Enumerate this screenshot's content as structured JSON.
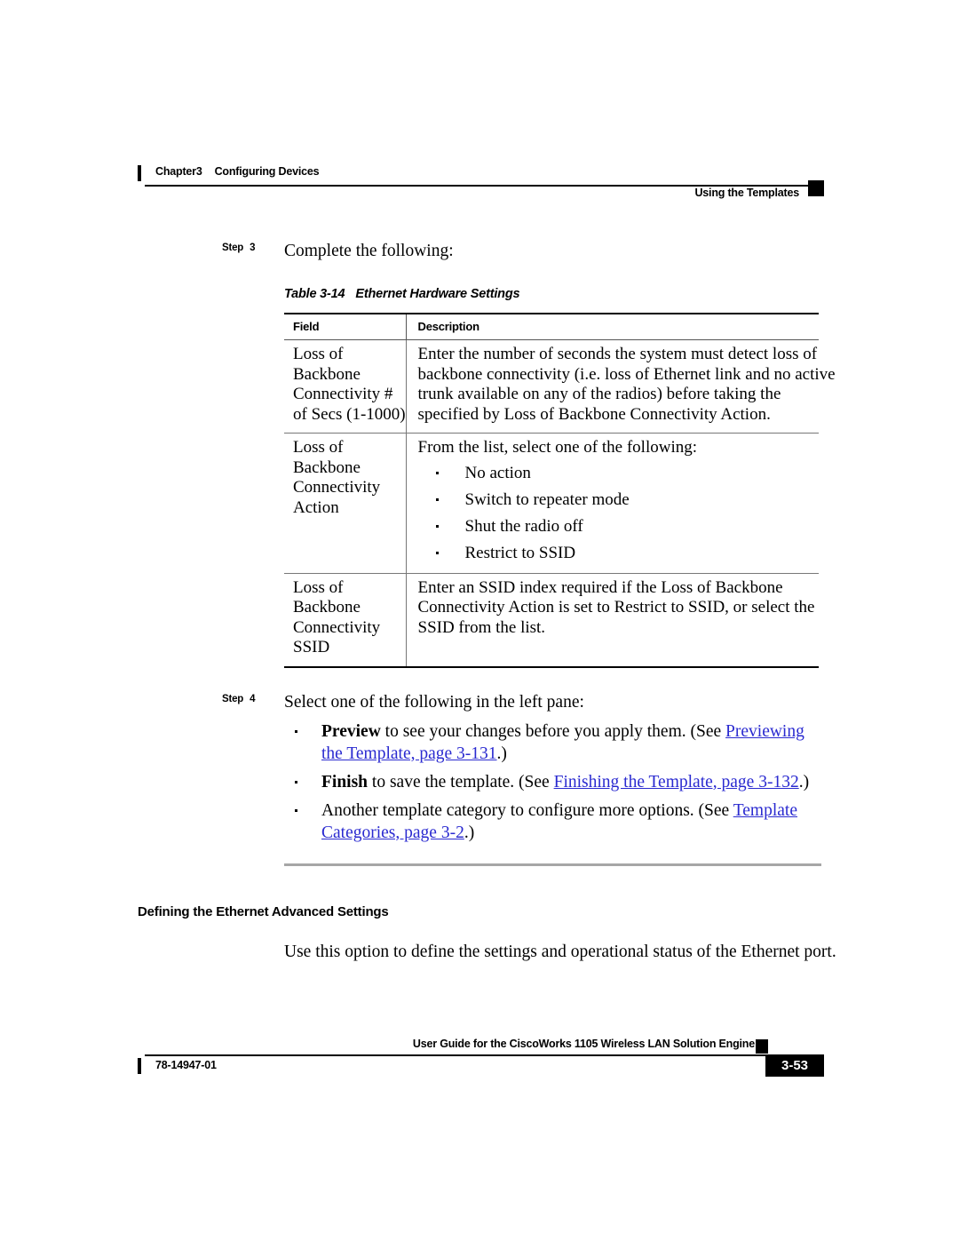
{
  "header": {
    "chapter_label": "Chapter",
    "chapter_number": "3",
    "chapter_title": "Configuring Devices",
    "section_title": "Using the Templates"
  },
  "step3": {
    "label": "Step",
    "number": "3",
    "text": "Complete the following:"
  },
  "table": {
    "caption_number": "Table 3-14",
    "caption_title": "Ethernet Hardware Settings",
    "columns": [
      "Field",
      "Description"
    ],
    "rows": [
      {
        "field_lines": [
          "Loss of",
          "Backbone",
          "Connectivity #",
          "of Secs (1-1000)"
        ],
        "desc_lines": [
          "Enter the number of seconds the system must detect loss of",
          "backbone connectivity (i.e. loss of Ethernet link and no active",
          "trunk available on any of the radios) before taking the",
          "specified by Loss of Backbone Connectivity Action."
        ],
        "bullets": []
      },
      {
        "field_lines": [
          "Loss of",
          "Backbone",
          "Connectivity",
          "Action"
        ],
        "desc_lines": [
          "From the list, select one of the following:"
        ],
        "bullets": [
          "No action",
          "Switch to repeater mode",
          "Shut the radio off",
          "Restrict to SSID"
        ]
      },
      {
        "field_lines": [
          "Loss of",
          "Backbone",
          "Connectivity",
          "SSID"
        ],
        "desc_lines": [
          "Enter an SSID index required if the Loss of Backbone",
          "Connectivity Action is set to Restrict to SSID, or select the",
          "SSID from the list."
        ],
        "bullets": []
      }
    ]
  },
  "step4": {
    "label": "Step",
    "number": "4",
    "text": "Select one of the following in the left pane:",
    "bullets": [
      {
        "bold": "Preview",
        "text_before": " to see your changes before you apply them. (See ",
        "link": "Previewing the Template, page 3-131",
        "text_after": ".)"
      },
      {
        "bold": "Finish",
        "text_before": " to save the template. (See ",
        "link": "Finishing the Template, page 3-132",
        "text_after": ".)"
      },
      {
        "bold": "",
        "text_before": "Another template category to configure more options. (See ",
        "link": "Template Categories, page 3-2",
        "text_after": ".)"
      }
    ]
  },
  "section": {
    "heading": "Defining the Ethernet Advanced Settings",
    "body": "Use this option to define the settings and operational status of the Ethernet port."
  },
  "footer": {
    "guide_title": "User Guide for the CiscoWorks 1105 Wireless LAN Solution Engine",
    "document_number": "78-14947-01",
    "page_number": "3-53"
  },
  "colors": {
    "link": "#2a2ad0",
    "rule": "#000000",
    "divider": "#a6a6a6"
  }
}
